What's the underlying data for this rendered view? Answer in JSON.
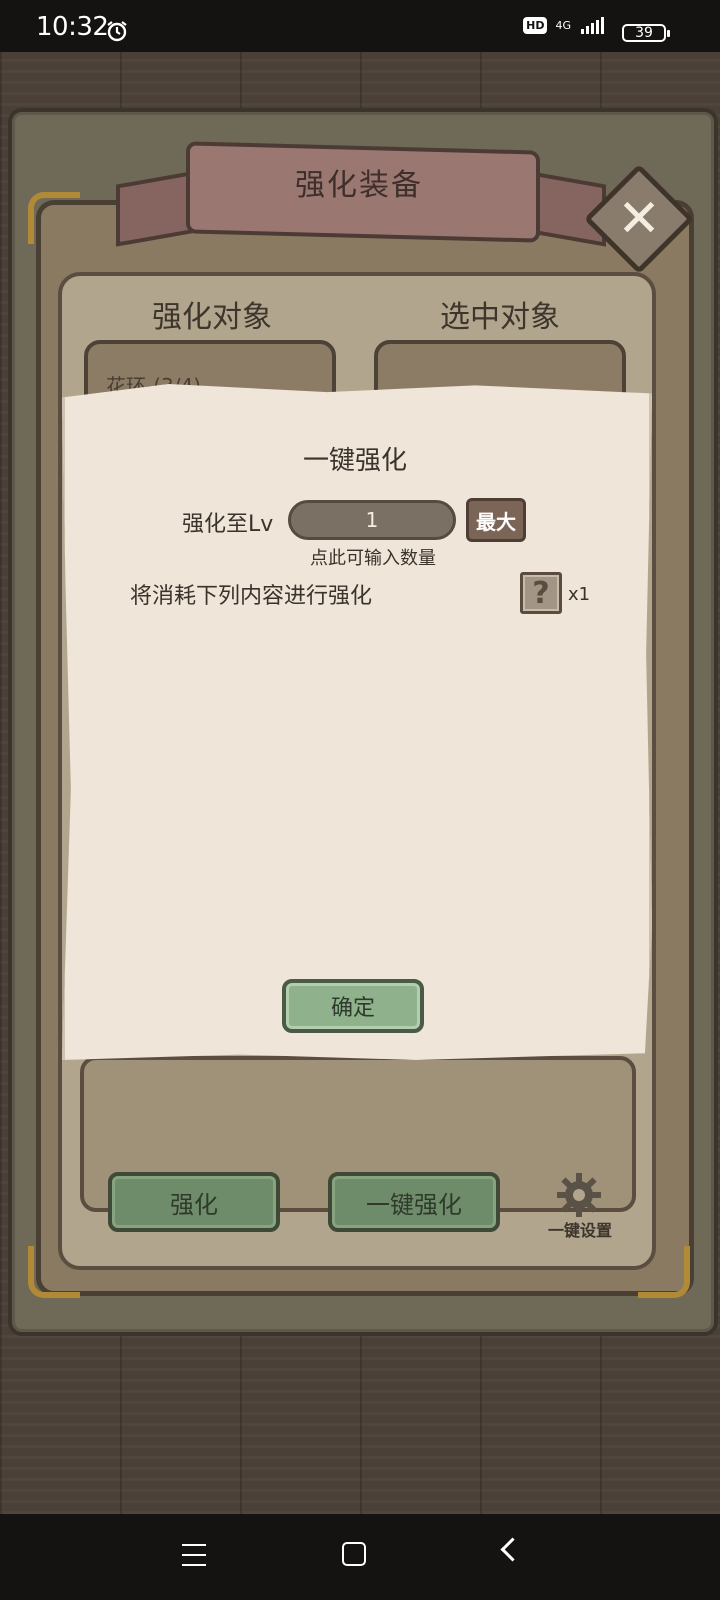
{
  "status_bar": {
    "time": "10:32",
    "hd": "HD",
    "network": "4G",
    "battery": "39"
  },
  "dialog_window": {
    "title": "强化装备",
    "close_icon": "close-x-icon",
    "left_section_label": "强化对象",
    "right_section_label": "选中对象",
    "selected_item": "花环-(3/4)",
    "buttons": {
      "upgrade": "强化",
      "one_click_upgrade": "一键强化",
      "one_click_settings": "一键设置"
    }
  },
  "popup": {
    "title": "一键强化",
    "upgrade_to_label": "强化至Lv",
    "level_value": "1",
    "max_button": "最大",
    "input_hint": "点此可输入数量",
    "consume_text": "将消耗下列内容进行强化",
    "consume_item_icon": "?",
    "consume_count": "x1",
    "confirm_button": "确定"
  },
  "colors": {
    "parchment": "#efe5d8",
    "green_button": "#8fb18b",
    "frame_gold": "#b18a37"
  }
}
